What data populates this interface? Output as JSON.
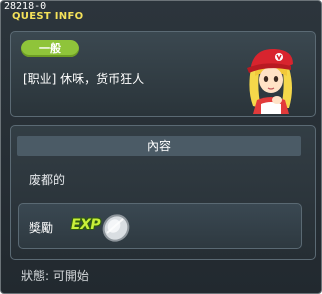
{
  "window": {
    "quest_id": "28218-0",
    "title": "QUEST INFO"
  },
  "quest": {
    "category_badge": "一般",
    "job_line": "[职业] 休咊，货币狂人"
  },
  "content": {
    "header": "內容",
    "description": "废都的"
  },
  "reward": {
    "label": "獎勵",
    "exp_text": "EXP",
    "coin_icon": "silver-coin-icon"
  },
  "footer": {
    "status": "狀態: 可開始"
  }
}
